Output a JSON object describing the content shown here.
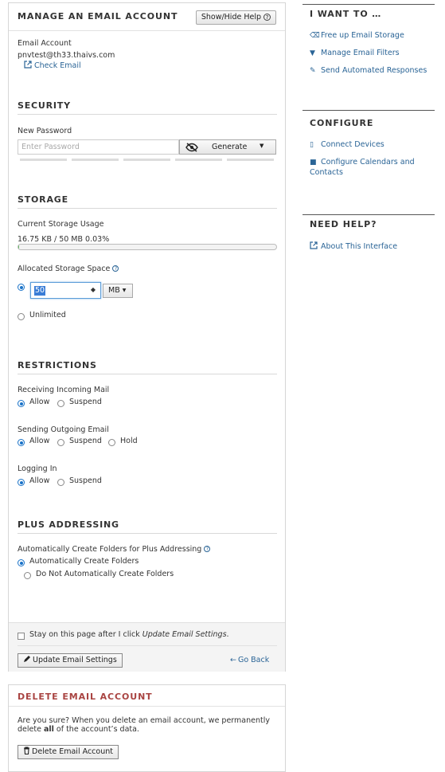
{
  "main": {
    "title": "MANAGE AN EMAIL ACCOUNT",
    "help_button": "Show/Hide Help",
    "account_label": "Email Account",
    "account_value": "pnvtest@th33.thaivs.com",
    "check_email_link": "Check Email",
    "security": {
      "title": "SECURITY",
      "new_password_label": "New Password",
      "password_placeholder": "Enter Password",
      "generate_button": "Generate"
    },
    "storage": {
      "title": "STORAGE",
      "current_usage_label": "Current Storage Usage",
      "usage_text": "16.75 KB / 50 MB 0.03%",
      "usage_percent": 0.03,
      "allocated_label": "Allocated Storage Space",
      "allocated_value": "50",
      "unit": "MB",
      "unlimited_label": "Unlimited"
    },
    "restrictions": {
      "title": "RESTRICTIONS",
      "incoming": {
        "label": "Receiving Incoming Mail",
        "allow": "Allow",
        "suspend": "Suspend"
      },
      "outgoing": {
        "label": "Sending Outgoing Email",
        "allow": "Allow",
        "suspend": "Suspend",
        "hold": "Hold"
      },
      "login": {
        "label": "Logging In",
        "allow": "Allow",
        "suspend": "Suspend"
      }
    },
    "plus": {
      "title": "PLUS ADDRESSING",
      "label": "Automatically Create Folders for Plus Addressing",
      "auto_option": "Automatically Create Folders",
      "no_auto_option": "Do Not Automatically Create Folders"
    },
    "footer": {
      "stay_prefix": "Stay on this page after I click ",
      "stay_italic": "Update Email Settings",
      "stay_suffix": ".",
      "update_button": "Update Email Settings",
      "go_back": "Go Back"
    }
  },
  "delete": {
    "title": "DELETE EMAIL ACCOUNT",
    "text_line1": "Are you sure? When you delete an email account, we permanently",
    "text_line2_pre": "delete ",
    "text_line2_bold": "all",
    "text_line2_post": " of the account’s data.",
    "button": "Delete Email Account"
  },
  "sidebar": {
    "want_title": "I WANT TO …",
    "want_links": [
      "Free up Email Storage",
      "Manage Email Filters",
      "Send Automated Responses"
    ],
    "configure_title": "CONFIGURE",
    "connect_devices": "Connect Devices",
    "calendars_line1": "Configure Calendars and",
    "calendars_line2": "Contacts",
    "help_title": "NEED HELP?",
    "about_link": "About This Interface"
  },
  "colors": {
    "link": "#2a6496",
    "delete_title": "#a94442",
    "radio_selected": "#1a73c8"
  },
  "icons": [
    "help-circle-icon",
    "external-link-icon",
    "eye-slash-icon",
    "caret-down-icon",
    "spinner-arrows-icon",
    "pencil-icon",
    "arrow-left-icon",
    "trash-icon",
    "eraser-icon",
    "filter-icon",
    "magic-wand-icon",
    "mobile-icon",
    "address-book-icon"
  ]
}
